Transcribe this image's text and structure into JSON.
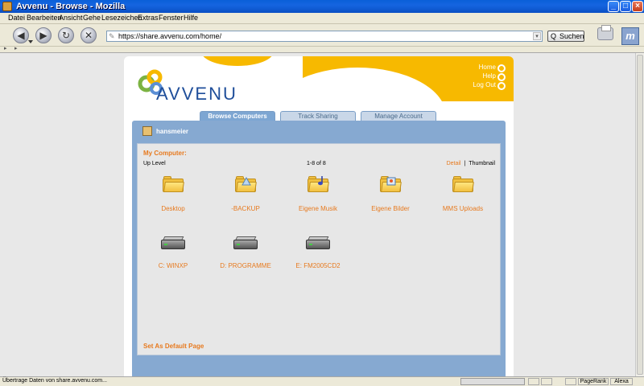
{
  "window": {
    "title": "Avvenu - Browse - Mozilla",
    "minimize_label": "_",
    "maximize_label": "□",
    "close_label": "×"
  },
  "menu": [
    "Datei",
    "Bearbeiten",
    "Ansicht",
    "Gehe",
    "Lesezeichen",
    "Extras",
    "Fenster",
    "Hilfe"
  ],
  "navbar": {
    "back_glyph": "◀",
    "forward_glyph": "▶",
    "reload_glyph": "↻",
    "stop_glyph": "✕",
    "url": "https://share.avvenu.com/home/",
    "url_dropdown_glyph": "▾",
    "lock_glyph": "✎",
    "search_label": "Suchen",
    "search_glyph": "Q",
    "throbber_glyph": "m"
  },
  "tabstrip": {
    "left_glyph": "▸",
    "right_glyph": "▸"
  },
  "page": {
    "logo_text": "AVVENU",
    "toplinks": [
      "Home",
      "Help",
      "Log Out"
    ],
    "tabs": [
      {
        "label": "Browse Computers",
        "active": true
      },
      {
        "label": "Track Sharing",
        "active": false
      },
      {
        "label": "Manage Account",
        "active": false
      }
    ],
    "username": "hansmeier",
    "section_title": "My Computer:",
    "up_level": "Up Level",
    "page_count": "1-8 of 8",
    "view_detail": "Detail",
    "view_separator": "|",
    "view_thumbnail": "Thumbnail",
    "items": [
      {
        "label": "Desktop",
        "icon": "folder-icon"
      },
      {
        "label": "-BACKUP",
        "icon": "folder-share-icon"
      },
      {
        "label": "Eigene Musik",
        "icon": "folder-music-icon"
      },
      {
        "label": "Eigene Bilder",
        "icon": "folder-pictures-icon"
      },
      {
        "label": "MMS Uploads",
        "icon": "folder-icon"
      },
      {
        "label": "C: WINXP",
        "icon": "hard-drive-icon"
      },
      {
        "label": "D: PROGRAMME",
        "icon": "hard-drive-icon"
      },
      {
        "label": "E: FM2005CD2",
        "icon": "hard-drive-icon"
      }
    ],
    "set_default": "Set As Default Page"
  },
  "status": {
    "text": "Übertrage Daten von share.avvenu.com...",
    "pagerank": "PageRank",
    "alexa": "Alexa"
  },
  "colors": {
    "brand_blue": "#1f4e9a",
    "brand_yellow": "#f7b900",
    "accent_orange": "#e77a1f",
    "panel_blue": "#86a9d1"
  }
}
